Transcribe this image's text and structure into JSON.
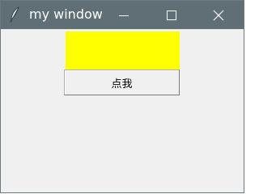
{
  "window": {
    "title": "my window"
  },
  "titlebar_controls": {
    "minimize_icon": "minimize-icon",
    "maximize_icon": "maximize-icon",
    "close_icon": "close-icon"
  },
  "content": {
    "color_box": "#ffff00",
    "button_label": "点我"
  },
  "colors": {
    "titlebar": "#5f6f75",
    "window_bg": "#f0f0f0"
  }
}
